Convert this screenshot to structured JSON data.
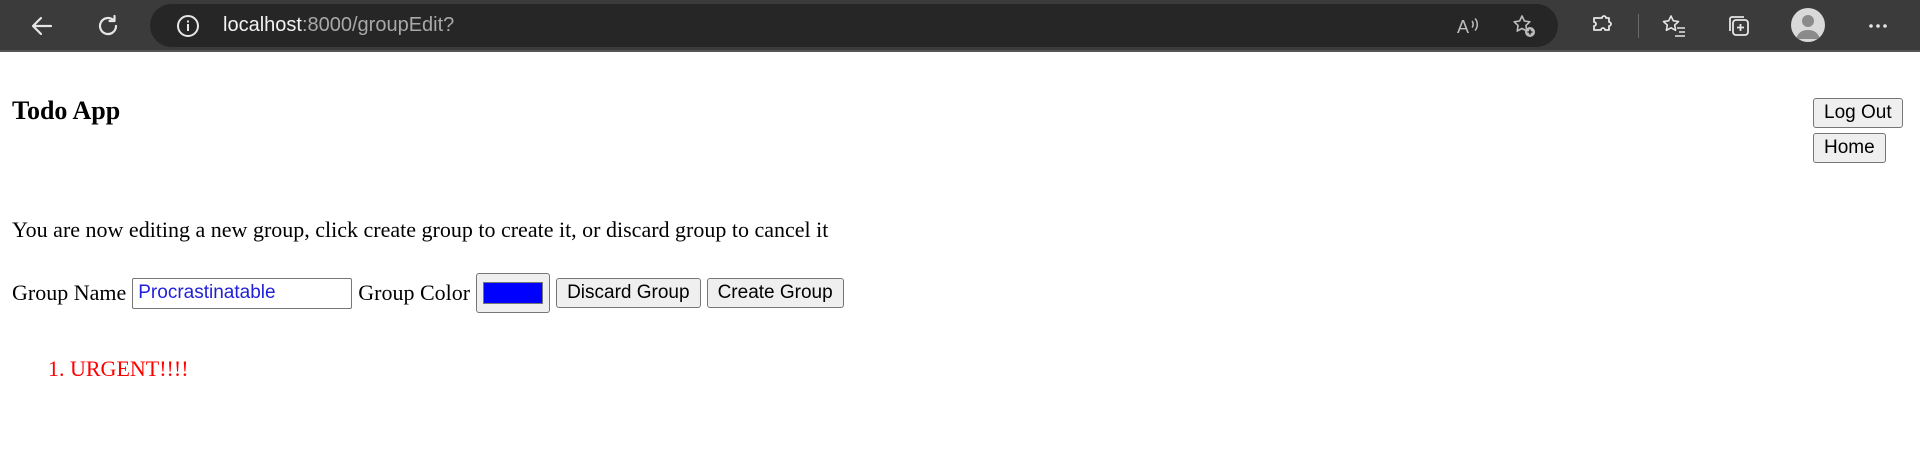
{
  "browser": {
    "url_host": "localhost",
    "url_rest": ":8000/groupEdit?",
    "icons": {
      "back": "back-arrow-icon",
      "reload": "reload-icon",
      "info": "info-icon",
      "read_aloud": "read-aloud-icon",
      "add_favorite": "add-favorite-icon",
      "extensions": "extensions-icon",
      "favorites": "favorites-icon",
      "collections": "collections-icon",
      "profile": "profile-avatar-icon",
      "more": "more-options-icon"
    }
  },
  "header": {
    "title": "Todo App",
    "logout_label": "Log Out",
    "home_label": "Home"
  },
  "main": {
    "intro": "You are now editing a new group, click create group to create it, or discard group to cancel it",
    "group_name_label": "Group Name",
    "group_name_value": "Procrastinatable",
    "group_color_label": "Group Color",
    "group_color_value": "#0000ff",
    "discard_label": "Discard Group",
    "create_label": "Create Group",
    "items": [
      {
        "number": "1.",
        "text": "URGENT!!!!",
        "color": "#ff0000"
      }
    ]
  }
}
